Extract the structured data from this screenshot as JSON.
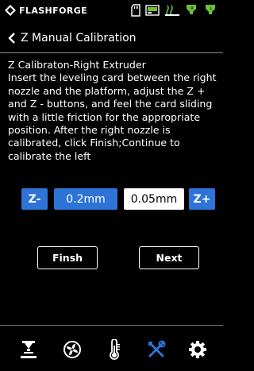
{
  "header": {
    "brand": "FLASHFORGE",
    "status_icons": [
      "sd-card-icon",
      "screen-icon",
      "build-plate-temp-icon",
      "extruder-right-temp-icon",
      "extruder-left-temp-icon"
    ]
  },
  "page": {
    "title": "Z Manual Calibration",
    "back_icon": "chevron-left-icon"
  },
  "instructions": {
    "heading": "Z Calibraton-Right Extruder",
    "body": "Insert the leveling card between the right nozzle and the platform, adjust the Z + and Z - buttons, and feel the card sliding with a little friction for the appropriate position. After the right nozzle is calibrated, click Finish;Continue to calibrate the left"
  },
  "controls": {
    "z_minus_label": "Z-",
    "step_large": "0.2mm",
    "step_small": "0.05mm",
    "z_plus_label": "Z+",
    "selected_step": "0.2mm"
  },
  "actions": {
    "finish_label": "Finsh",
    "next_label": "Next"
  },
  "bottom_nav": {
    "items": [
      "print-icon",
      "fan-icon",
      "temperature-icon",
      "tools-icon",
      "settings-icon"
    ],
    "active": "tools-icon"
  },
  "colors": {
    "accent": "#2e74d6",
    "background": "#000000",
    "temp_icon_green": "#6fbf3a"
  }
}
